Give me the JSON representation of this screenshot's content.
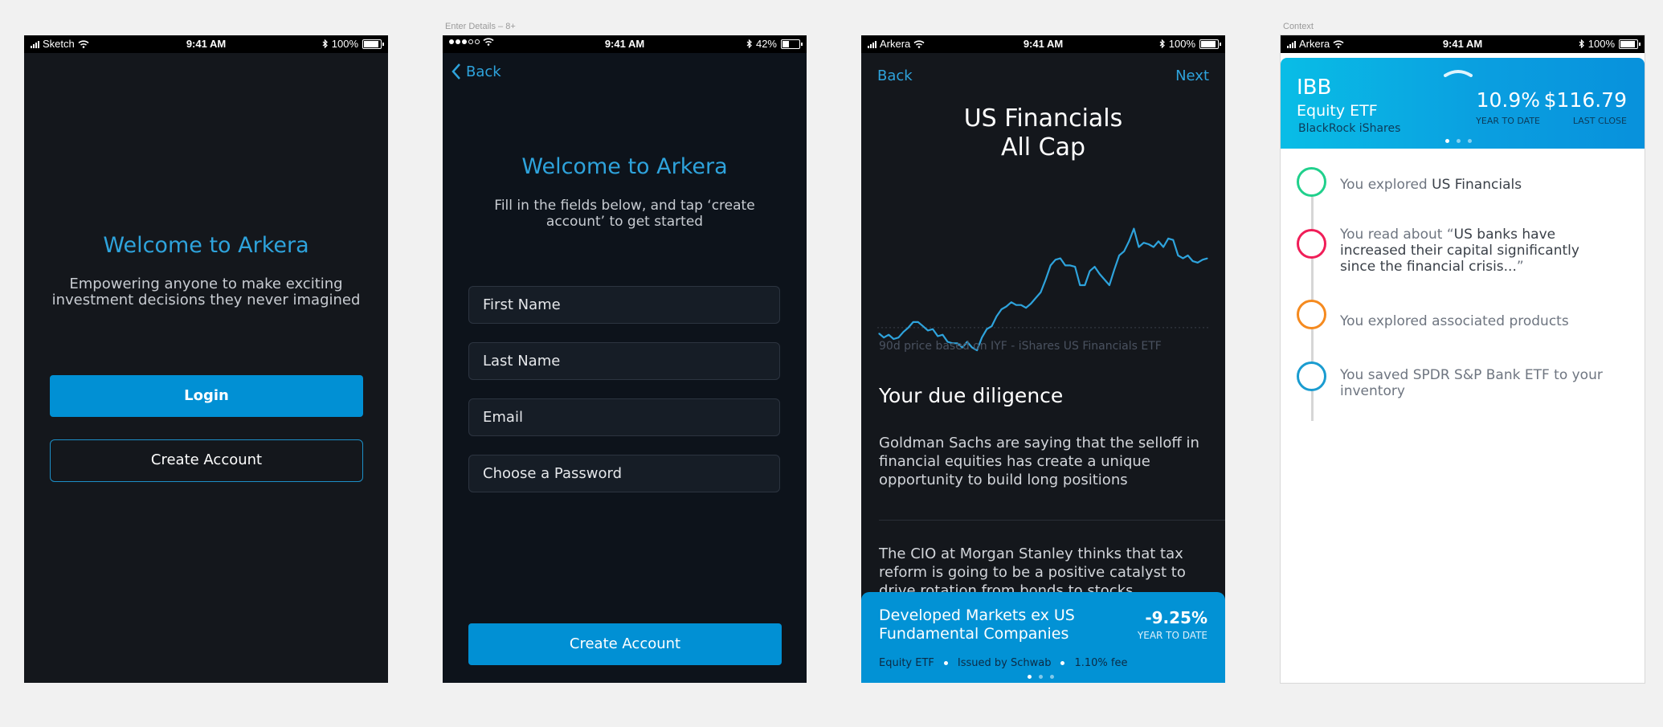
{
  "artboards": {
    "screen2_label": "Enter Details – 8+",
    "screen4_label": "Context"
  },
  "status": {
    "time": "9:41 AM",
    "screen1": {
      "carrier": "Sketch",
      "battery": "100%"
    },
    "screen2": {
      "carrier": "",
      "battery": "42%"
    },
    "screen3": {
      "carrier": "Arkera",
      "battery": "100%"
    },
    "screen4": {
      "carrier": "Arkera",
      "battery": "100%"
    }
  },
  "screen1": {
    "title": "Welcome to Arkera",
    "subtitle_line1": "Empowering anyone to make exciting",
    "subtitle_line2": "investment decisions they never imagined",
    "login_label": "Login",
    "create_account_label": "Create Account"
  },
  "screen2": {
    "back_label": "Back",
    "title": "Welcome to Arkera",
    "subtitle_line1": "Fill in the fields below, and tap ‘create",
    "subtitle_line2": "account’ to get started",
    "fields": {
      "first_name": "First Name",
      "last_name": "Last Name",
      "email": "Email",
      "password": "Choose a Password"
    },
    "create_account_label": "Create Account"
  },
  "screen3": {
    "back_label": "Back",
    "next_label": "Next",
    "title_line1": "US Financials",
    "title_line2": "All Cap",
    "chart_note": "90d price based on IYF - iShares US Financials ETF",
    "section_title": "Your due diligence",
    "para1_line1": "Goldman Sachs are saying that the selloff in",
    "para1_line2": "financial equities has create a unique",
    "para1_line3": "opportunity to build long positions",
    "para2_line1": "The CIO at Morgan Stanley thinks that tax",
    "para2_line2": "reform is going to be a positive catalyst to",
    "para2_line3": "drive rotation from bonds to stocks",
    "promo": {
      "title_line1": "Developed Markets ex US",
      "title_line2": "Fundamental Companies",
      "value": "-9.25%",
      "value_caption": "YEAR TO DATE",
      "type": "Equity ETF",
      "issuer": "Issued by Schwab",
      "fee": "1.10% fee"
    },
    "chart_data": {
      "type": "line",
      "title": "",
      "series": [
        {
          "values": [
            25,
            22,
            24,
            21,
            22,
            26,
            29,
            33,
            33,
            30,
            27,
            28,
            23,
            24,
            19,
            18,
            18,
            15,
            19,
            15,
            13,
            22,
            28,
            30,
            37,
            42,
            44,
            47,
            45,
            45,
            43,
            46,
            50,
            54,
            63,
            73,
            77,
            78,
            73,
            73,
            72,
            59,
            59,
            69,
            72,
            67,
            63,
            59,
            70,
            80,
            83,
            90,
            99,
            86,
            89,
            88,
            86,
            90,
            86,
            92,
            91,
            80,
            78,
            80,
            76,
            75,
            77,
            78
          ]
        }
      ],
      "baseline": 29,
      "ylim": [
        0,
        105
      ],
      "grid": false
    }
  },
  "screen4": {
    "ticker": "IBB",
    "fund_type": "Equity ETF",
    "issuer": "BlackRock iShares",
    "ytd_value": "10.9%",
    "ytd_caption": "YEAR TO DATE",
    "close_value": "$116.79",
    "close_caption": "LAST CLOSE",
    "timeline": [
      {
        "prefix": "You explored ",
        "bold": "US Financials",
        "suffix": "",
        "color": "#20d08c"
      },
      {
        "prefix": "You read about “",
        "bold": "US banks have increased their capital significantly since the financial crisis...",
        "suffix": "”",
        "color": "#f01e58"
      },
      {
        "prefix": "You explored associated products",
        "bold": "",
        "suffix": "",
        "color": "#f58a1f"
      },
      {
        "prefix": "You saved SPDR S&P Bank ETF to your inventory",
        "bold": "",
        "suffix": "",
        "color": "#1a9cd0"
      }
    ]
  }
}
